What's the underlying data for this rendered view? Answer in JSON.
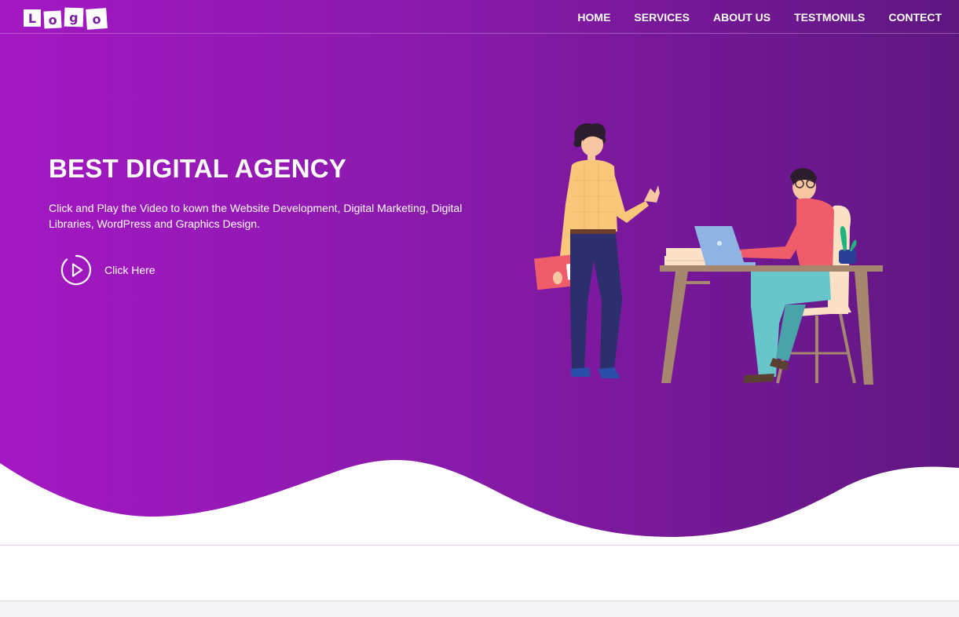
{
  "nav": {
    "logo_letters": [
      "L",
      "o",
      "g",
      "o"
    ],
    "items": [
      {
        "label": "HOME"
      },
      {
        "label": "SERVICES"
      },
      {
        "label": "ABOUT US"
      },
      {
        "label": "TESTMONILS"
      },
      {
        "label": "CONTECT"
      }
    ]
  },
  "hero": {
    "title": "BEST DIGITAL AGENCY",
    "description": "Click and Play the Video to kown the Website Development, Digital Marketing, Digital Libraries, WordPress and Graphics Design.",
    "cta_label": "Click Here",
    "cta_icon": "play-circle-icon",
    "illustration": "office-illustration"
  },
  "colors": {
    "gradient_start": "#a318c2",
    "gradient_end": "#5f1780",
    "text": "#ffffff"
  }
}
